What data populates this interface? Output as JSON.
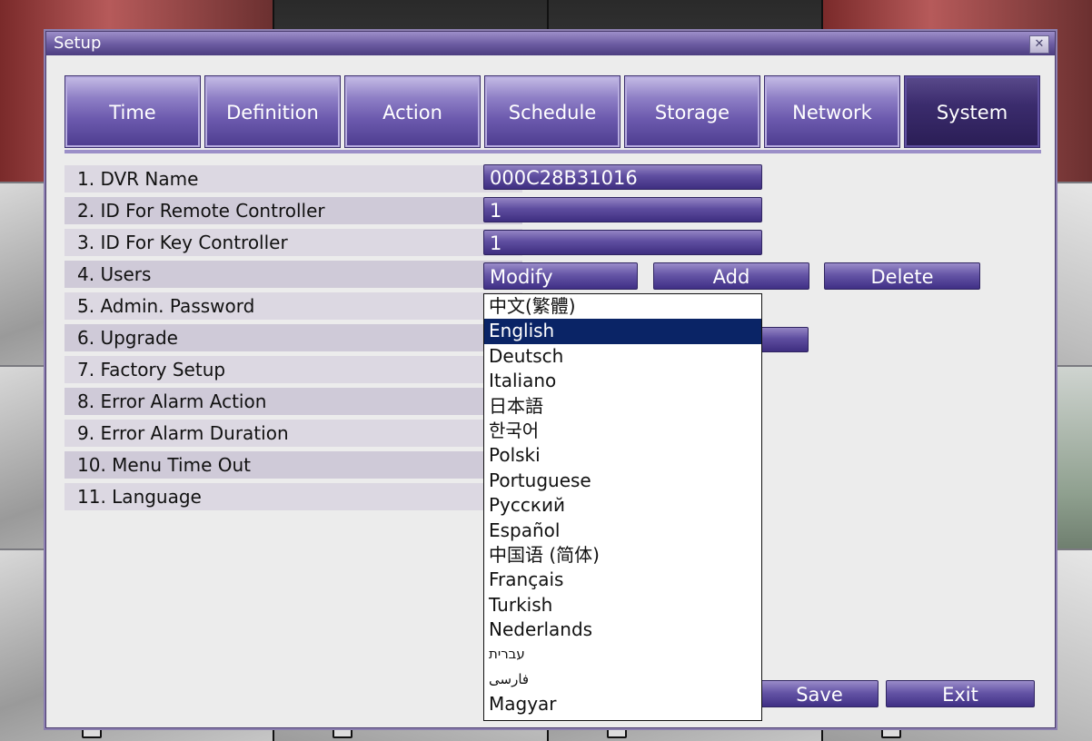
{
  "window": {
    "title": "Setup",
    "close_glyph": "✕"
  },
  "tabs": [
    {
      "label": "Time"
    },
    {
      "label": "Definition"
    },
    {
      "label": "Action"
    },
    {
      "label": "Schedule"
    },
    {
      "label": "Storage"
    },
    {
      "label": "Network"
    },
    {
      "label": "System",
      "active": true
    }
  ],
  "settings": [
    {
      "label": "1. DVR Name"
    },
    {
      "label": "2. ID For Remote Controller"
    },
    {
      "label": "3. ID For Key Controller"
    },
    {
      "label": "4. Users"
    },
    {
      "label": "5. Admin. Password"
    },
    {
      "label": "6. Upgrade"
    },
    {
      "label": "7. Factory Setup"
    },
    {
      "label": "8. Error Alarm Action"
    },
    {
      "label": "9. Error Alarm Duration"
    },
    {
      "label": "10. Menu Time Out"
    },
    {
      "label": "11. Language"
    }
  ],
  "values": {
    "dvr_name": "000C28B31016",
    "remote_id": "1",
    "key_id": "1"
  },
  "users_buttons": {
    "modify": "Modify",
    "add": "Add",
    "delete": "Delete"
  },
  "language_options": [
    "中文(繁體)",
    "English",
    "Deutsch",
    "Italiano",
    "日本語",
    "한국어",
    "Polski",
    "Portuguese",
    "Русский",
    "Español",
    "中国语 (简体)",
    "Français",
    "Turkish",
    "Nederlands",
    "עברית",
    "فارسی",
    "Magyar"
  ],
  "language_selected": "English",
  "footer": {
    "save": "Save",
    "exit": "Exit"
  },
  "colors": {
    "accent": "#5a4a9c",
    "selection": "#0a2466",
    "titlebar": "#6a5aa0"
  }
}
